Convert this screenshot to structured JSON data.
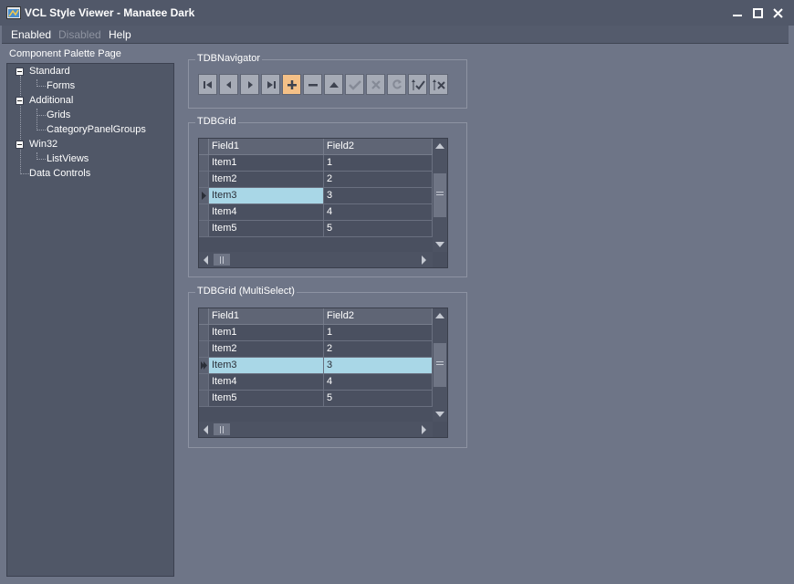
{
  "window": {
    "title": "VCL Style Viewer - Manatee Dark"
  },
  "menu": [
    "Enabled",
    "Disabled",
    "Help"
  ],
  "palette": {
    "label": "Component Palette Page",
    "nodes": [
      "Standard",
      "Forms",
      "Additional",
      "Grids",
      "CategoryPanelGroups",
      "Win32",
      "ListViews",
      "Data Controls"
    ]
  },
  "navigator": {
    "label": "TDBNavigator"
  },
  "grid1": {
    "label": "TDBGrid",
    "columns": [
      "Field1",
      "Field2"
    ],
    "rows": [
      [
        "Item1",
        "1"
      ],
      [
        "Item2",
        "2"
      ],
      [
        "Item3",
        "3"
      ],
      [
        "Item4",
        "4"
      ],
      [
        "Item5",
        "5"
      ]
    ]
  },
  "grid2": {
    "label": "TDBGrid (MultiSelect)",
    "columns": [
      "Field1",
      "Field2"
    ],
    "rows": [
      [
        "Item1",
        "1"
      ],
      [
        "Item2",
        "2"
      ],
      [
        "Item3",
        "3"
      ],
      [
        "Item4",
        "4"
      ],
      [
        "Item5",
        "5"
      ]
    ]
  },
  "colors": {
    "accent": "#f4c087",
    "selection": "#a9d7e7",
    "background": "#6e7587"
  }
}
